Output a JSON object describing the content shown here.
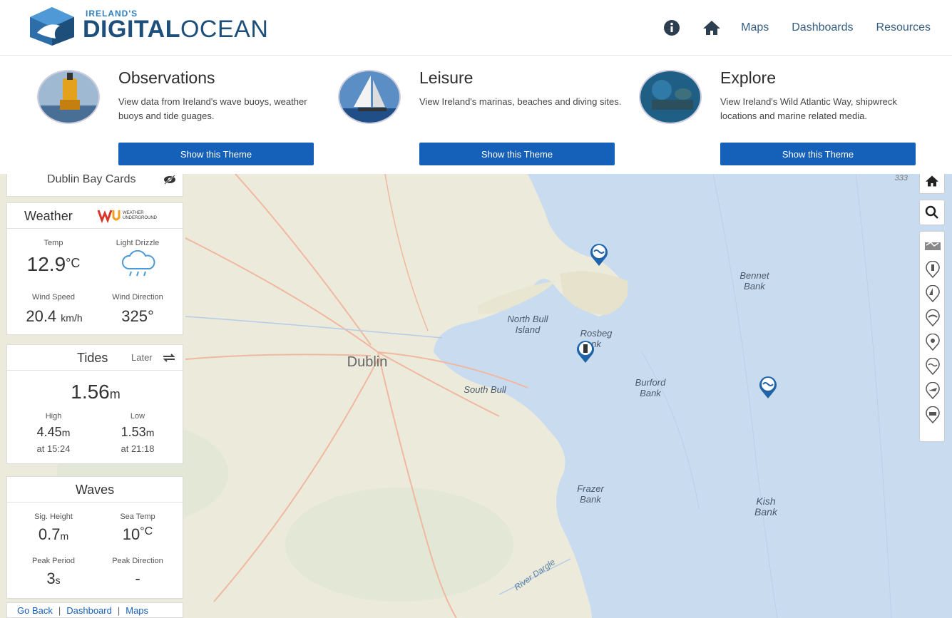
{
  "header": {
    "logo_small": "IRELAND'S",
    "logo_bold": "DIGITAL",
    "logo_light": "OCEAN",
    "nav": [
      "Maps",
      "Dashboards",
      "Resources"
    ]
  },
  "themes": [
    {
      "title": "Observations",
      "desc": "View data from Ireland's wave buoys, weather buoys and tide guages.",
      "button": "Show this Theme"
    },
    {
      "title": "Leisure",
      "desc": "View Ireland's marinas, beaches and diving sites.",
      "button": "Show this Theme"
    },
    {
      "title": "Explore",
      "desc": "View Ireland's Wild Atlantic Way, shipwreck locations and marine related media.",
      "button": "Show this Theme"
    }
  ],
  "sidebar": {
    "dublin_title": "Dublin Bay Cards",
    "weather": {
      "title": "Weather",
      "logo_text": "WEATHER UNDERGROUND",
      "temp_label": "Temp",
      "temp_value": "12.9",
      "temp_unit": "°C",
      "condition": "Light Drizzle",
      "wind_speed_label": "Wind Speed",
      "wind_speed_value": "20.4",
      "wind_speed_unit": "km/h",
      "wind_dir_label": "Wind Direction",
      "wind_dir_value": "325°"
    },
    "tides": {
      "title": "Tides",
      "later": "Later",
      "current_value": "1.56",
      "current_unit": "m",
      "high_label": "High",
      "high_value": "4.45",
      "high_unit": "m",
      "high_time": "at 15:24",
      "low_label": "Low",
      "low_value": "1.53",
      "low_unit": "m",
      "low_time": "at 21:18"
    },
    "waves": {
      "title": "Waves",
      "sig_height_label": "Sig. Height",
      "sig_height_value": "0.7",
      "sig_height_unit": "m",
      "sea_temp_label": "Sea Temp",
      "sea_temp_value": "10",
      "sea_temp_unit": "°C",
      "peak_period_label": "Peak Period",
      "peak_period_value": "3",
      "peak_period_unit": "s",
      "peak_dir_label": "Peak Direction",
      "peak_dir_value": "-"
    },
    "footer": {
      "go_back": "Go Back",
      "dashboard": "Dashboard",
      "maps": "Maps"
    }
  },
  "map": {
    "scale_text": "333",
    "labels": {
      "dublin": "Dublin",
      "north_bull_1": "North Bull",
      "north_bull_2": "Island",
      "rosbeg_1": "Rosbeg",
      "rosbeg_2": "nk",
      "south_bull": "South Bull",
      "burford_1": "Burford",
      "burford_2": "Bank",
      "bennet_1": "Bennet",
      "bennet_2": "Bank",
      "frazer_1": "Frazer",
      "frazer_2": "Bank",
      "kish_1": "Kish",
      "kish_2": "Bank",
      "river": "River Dargle"
    }
  },
  "colors": {
    "accent": "#1560b8",
    "logo_blue": "#1d4f7a",
    "sea": "#c9dbef",
    "land": "#eceadb"
  }
}
